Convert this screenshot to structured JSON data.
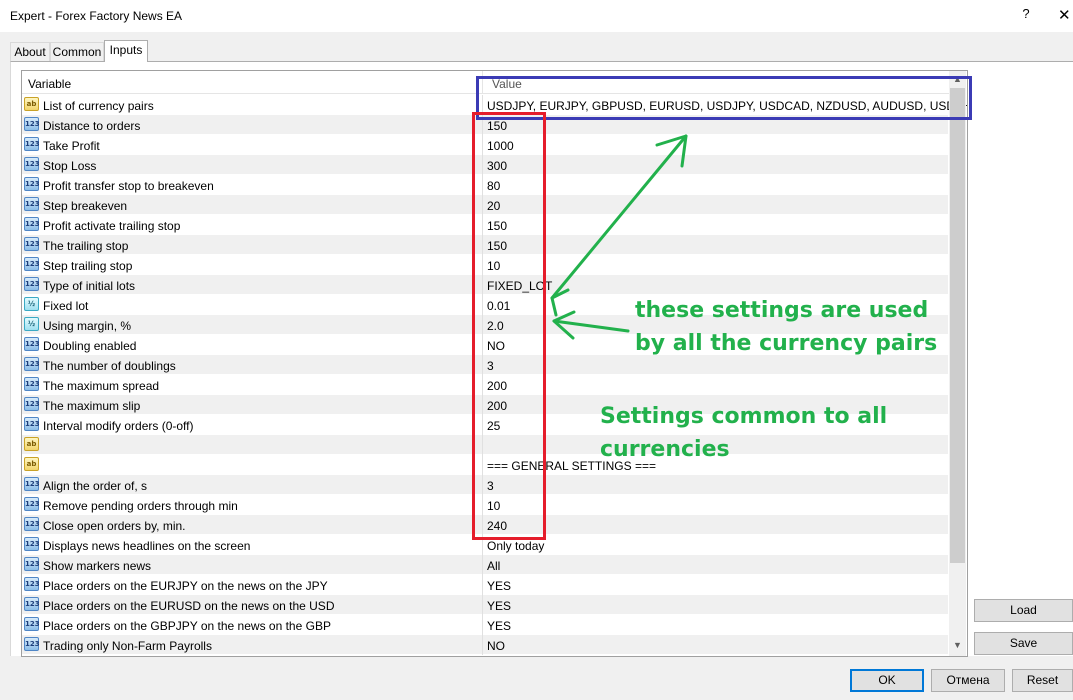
{
  "window": {
    "title": "Expert - Forex Factory News EA",
    "help_label": "?",
    "close_label": "✕"
  },
  "tabs": [
    {
      "label": "About",
      "active": false
    },
    {
      "label": "Common",
      "active": false
    },
    {
      "label": "Inputs",
      "active": true
    }
  ],
  "grid": {
    "header": {
      "variable": "Variable",
      "value": "Value"
    },
    "rows": [
      {
        "icon": "ab",
        "name": "List of currency pairs",
        "value": "USDJPY, EURJPY, GBPUSD, EURUSD, USDJPY, USDCAD, NZDUSD, AUDUSD, USDCHF..."
      },
      {
        "icon": "123",
        "name": "Distance to orders",
        "value": "150"
      },
      {
        "icon": "123",
        "name": "Take Profit",
        "value": "1000"
      },
      {
        "icon": "123",
        "name": "Stop Loss",
        "value": "300"
      },
      {
        "icon": "123",
        "name": "Profit transfer stop to breakeven",
        "value": "80"
      },
      {
        "icon": "123",
        "name": "Step breakeven",
        "value": "20"
      },
      {
        "icon": "123",
        "name": "Profit activate trailing stop",
        "value": "150"
      },
      {
        "icon": "123",
        "name": "The trailing stop",
        "value": "150"
      },
      {
        "icon": "123",
        "name": "Step trailing stop",
        "value": "10"
      },
      {
        "icon": "123",
        "name": "Type of initial lots",
        "value": "FIXED_LOT"
      },
      {
        "icon": "½",
        "name": "Fixed lot",
        "value": "0.01"
      },
      {
        "icon": "½",
        "name": "Using margin, %",
        "value": "2.0"
      },
      {
        "icon": "123",
        "name": "Doubling enabled",
        "value": "NO"
      },
      {
        "icon": "123",
        "name": "The number of doublings",
        "value": "3"
      },
      {
        "icon": "123",
        "name": "The maximum spread",
        "value": "200"
      },
      {
        "icon": "123",
        "name": "The maximum slip",
        "value": "200"
      },
      {
        "icon": "123",
        "name": "Interval modify orders (0-off)",
        "value": "25"
      },
      {
        "icon": "ab",
        "name": "",
        "value": ""
      },
      {
        "icon": "ab",
        "name": "",
        "value": "=== GENERAL SETTINGS ==="
      },
      {
        "icon": "123",
        "name": "Align the order of, s",
        "value": "3"
      },
      {
        "icon": "123",
        "name": "Remove pending orders through min",
        "value": "10"
      },
      {
        "icon": "123",
        "name": "Close open orders by, min.",
        "value": "240"
      },
      {
        "icon": "123",
        "name": "Displays news headlines on the screen",
        "value": "Only today"
      },
      {
        "icon": "123",
        "name": "Show markers news",
        "value": "All"
      },
      {
        "icon": "123",
        "name": "Place orders on the EURJPY on the news on the JPY",
        "value": "YES"
      },
      {
        "icon": "123",
        "name": "Place orders on the EURUSD on the news on the USD",
        "value": "YES"
      },
      {
        "icon": "123",
        "name": "Place orders on the GBPJPY on the news on the GBP",
        "value": "YES"
      },
      {
        "icon": "123",
        "name": "Trading only Non-Farm Payrolls",
        "value": "NO"
      }
    ]
  },
  "side_buttons": {
    "load": "Load",
    "save": "Save"
  },
  "footer_buttons": {
    "ok": "OK",
    "cancel": "Отмена",
    "reset": "Reset"
  },
  "annotations": {
    "used_by_all_line1": "these settings are used",
    "used_by_all_line2": "by all the currency pairs",
    "common_line1": "Settings common to all",
    "common_line2": "currencies"
  },
  "colors": {
    "annotation_text": "#22b14c",
    "blue_box": "#3b3bb5",
    "red_box": "#e51d2b",
    "accent": "#0078d7"
  }
}
